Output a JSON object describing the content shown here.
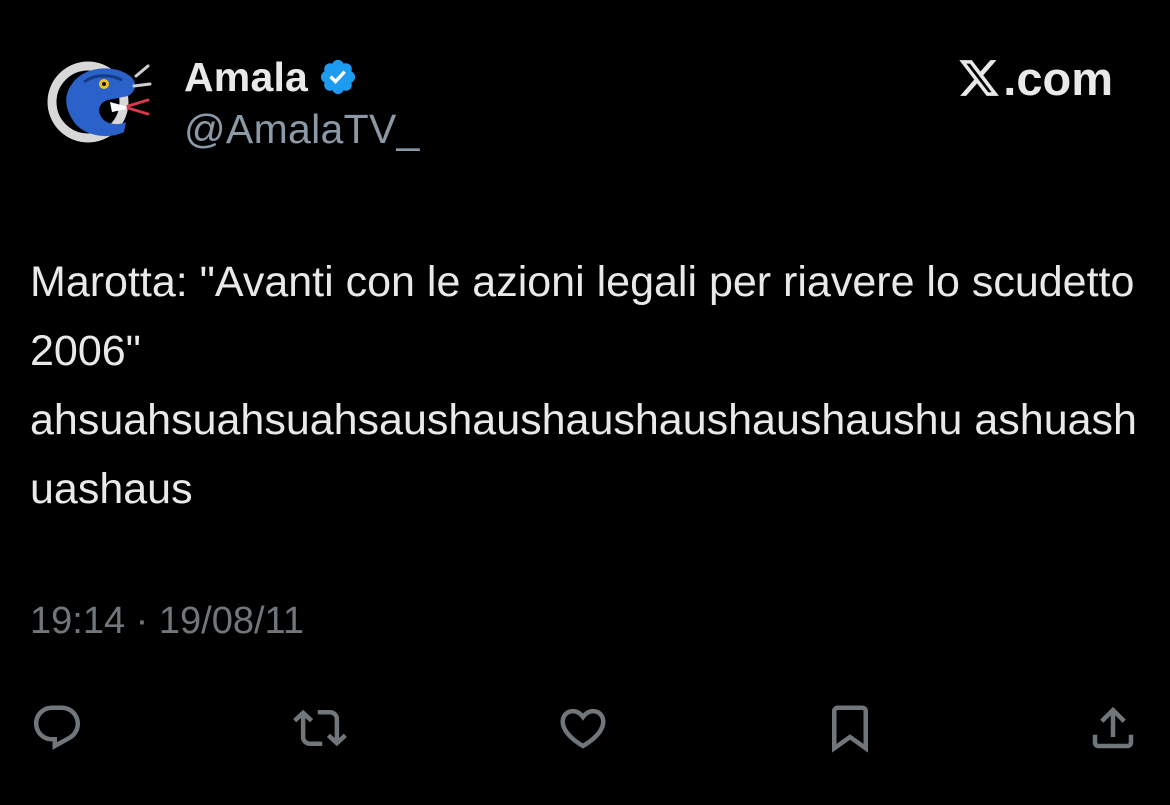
{
  "author": {
    "display_name": "Amala",
    "handle": "@AmalaTV_",
    "verified": true,
    "avatar_icon": "snake-logo-avatar"
  },
  "brand": {
    "logo_icon": "x-logo-icon",
    "text": ".com"
  },
  "tweet": {
    "text": "Marotta: \"Avanti con le azioni legali per riavere lo scudetto 2006\"\nahsuahsuahsuahsaushaushaushaushaushaushu ashuashuashaus",
    "timestamp": "19:14 · 19/08/11"
  },
  "actions": [
    {
      "name": "reply",
      "icon": "reply-icon"
    },
    {
      "name": "retweet",
      "icon": "retweet-icon"
    },
    {
      "name": "like",
      "icon": "heart-icon"
    },
    {
      "name": "bookmark",
      "icon": "bookmark-icon"
    },
    {
      "name": "share",
      "icon": "share-icon"
    }
  ],
  "colors": {
    "background": "#000000",
    "text": "#e7e9ea",
    "secondary_text": "#71767b",
    "verified_blue": "#1d9bf0"
  }
}
